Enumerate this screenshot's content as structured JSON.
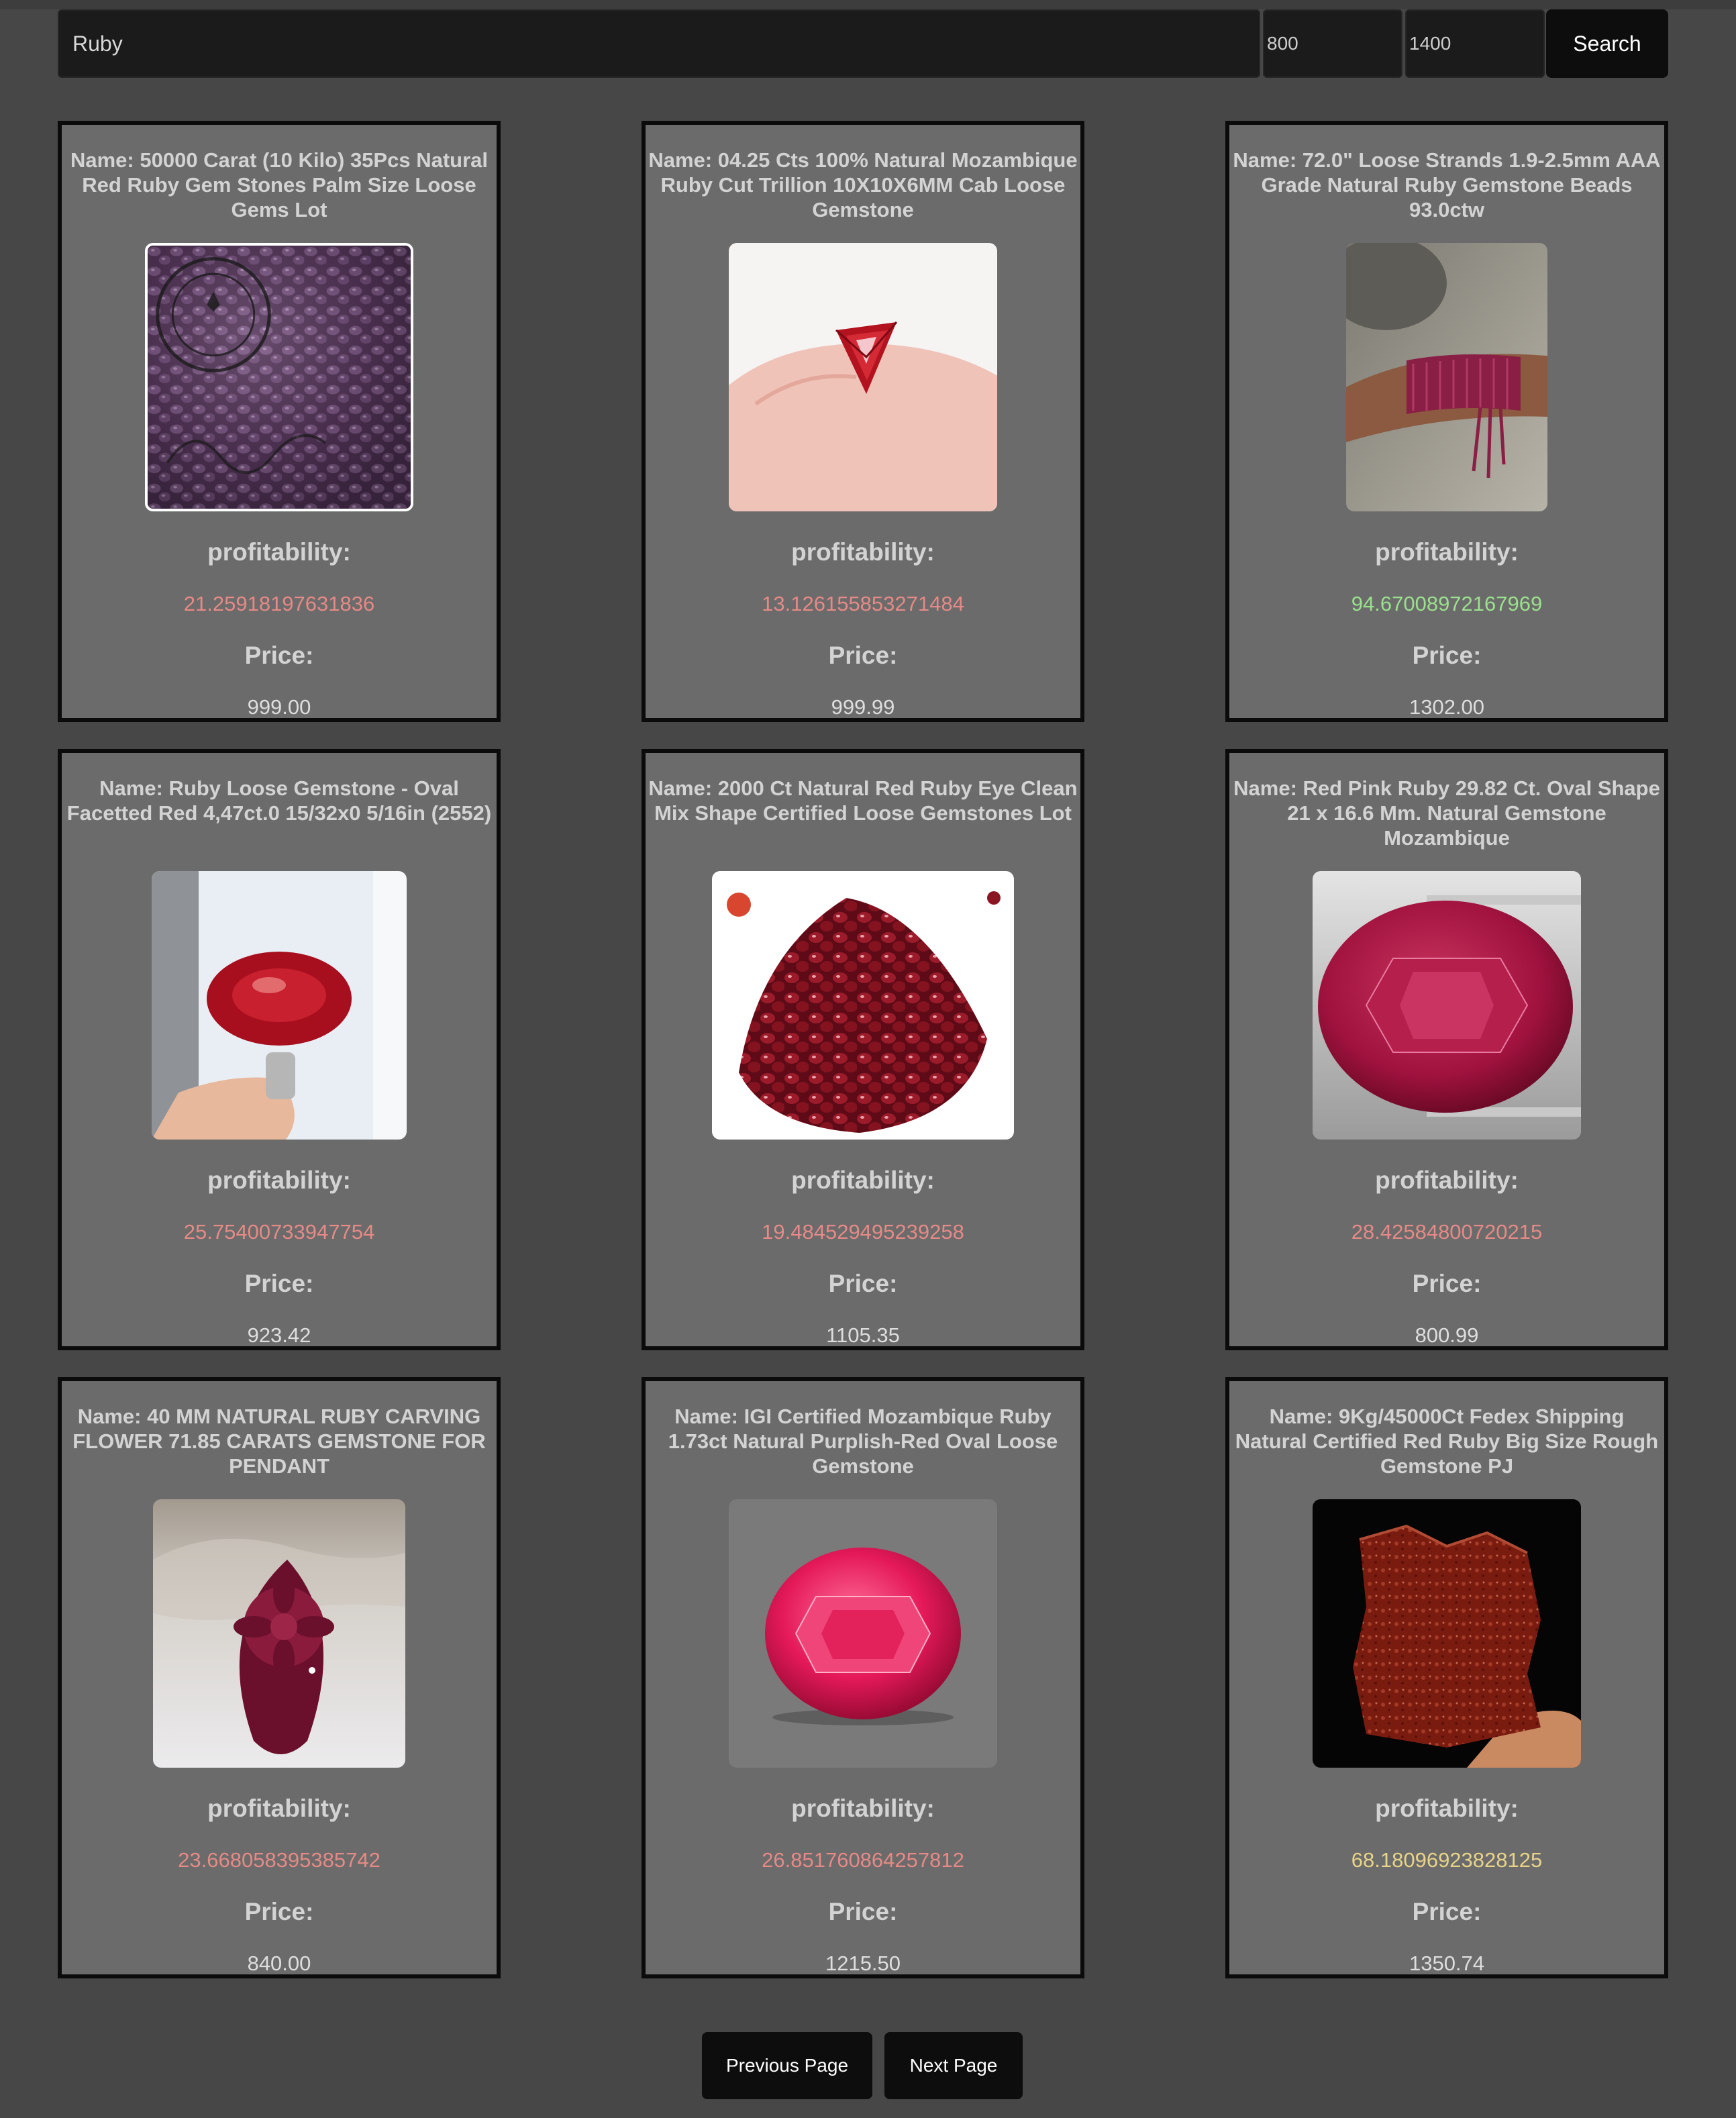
{
  "search": {
    "query": "Ruby",
    "min_price": "800",
    "max_price": "1400",
    "button_label": "Search"
  },
  "colors": {
    "profit_low": "#e58a86",
    "profit_high": "#9be08d",
    "profit_mid": "#e8d488"
  },
  "labels": {
    "profitability": "profitability:",
    "price": "Price:"
  },
  "products": [
    {
      "name": "Name: 50000 Carat (10 Kilo) 35Pcs Natural Red Ruby Gem Stones Palm Size Loose Gems Lot",
      "profitability": "21.25918197631836",
      "price": "999.00",
      "profit_color": "#e58a86",
      "image_icon": "pile-of-rubies-with-gemsindia-stamp-image",
      "image_stamp_text": "Hand Crafted GEMSINDIA Made in India Gemsindia"
    },
    {
      "name": "Name: 04.25 Cts 100% Natural Mozambique Ruby Cut Trillion 10X10X6MM Cab Loose Gemstone",
      "profitability": "13.126155853271484",
      "price": "999.99",
      "profit_color": "#e58a86",
      "image_icon": "trillion-ruby-on-fingertip-image"
    },
    {
      "name": "Name: 72.0\" Loose Strands 1.9-2.5mm AAA Grade Natural Ruby Gemstone Beads 93.0ctw",
      "profitability": "94.67008972167969",
      "price": "1302.00",
      "profit_color": "#9be08d",
      "image_icon": "ruby-bead-strands-on-wrist-image"
    },
    {
      "name": "Name: Ruby Loose Gemstone - Oval Facetted Red 4,47ct.0 15/32x0 5/16in (2552)",
      "profitability": "25.75400733947754",
      "price": "923.42",
      "profit_color": "#e58a86",
      "image_icon": "oval-ruby-in-prongs-image"
    },
    {
      "name": "Name: 2000 Ct Natural Red Ruby Eye Clean Mix Shape Certified Loose Gemstones Lot",
      "profitability": "19.484529495239258",
      "price": "1105.35",
      "profit_color": "#e58a86",
      "image_icon": "pile-of-mixed-rubies-image"
    },
    {
      "name": "Name: Red Pink Ruby 29.82 Ct. Oval Shape 21 x 16.6 Mm. Natural Gemstone Mozambique",
      "profitability": "28.42584800720215",
      "price": "800.99",
      "profit_color": "#e58a86",
      "image_icon": "large-oval-ruby-in-tweezers-image"
    },
    {
      "name": "Name: 40 MM NATURAL RUBY CARVING FLOWER 71.85 CARATS GEMSTONE FOR PENDANT",
      "profitability": "23.668058395385742",
      "price": "840.00",
      "profit_color": "#e58a86",
      "image_icon": "carved-ruby-flower-image"
    },
    {
      "name": "Name: IGI Certified Mozambique Ruby 1.73ct Natural Purplish-Red Oval Loose Gemstone",
      "profitability": "26.851760864257812",
      "price": "1215.50",
      "profit_color": "#e58a86",
      "image_icon": "oval-ruby-on-grey-image"
    },
    {
      "name": "Name: 9Kg/45000Ct Fedex Shipping Natural Certified Red Ruby Big Size Rough Gemstone PJ",
      "profitability": "68.18096923828125",
      "price": "1350.74",
      "profit_color": "#e8d488",
      "image_icon": "rough-ruby-block-in-hand-image"
    }
  ],
  "pagination": {
    "prev_label": "Previous Page",
    "next_label": "Next Page"
  }
}
